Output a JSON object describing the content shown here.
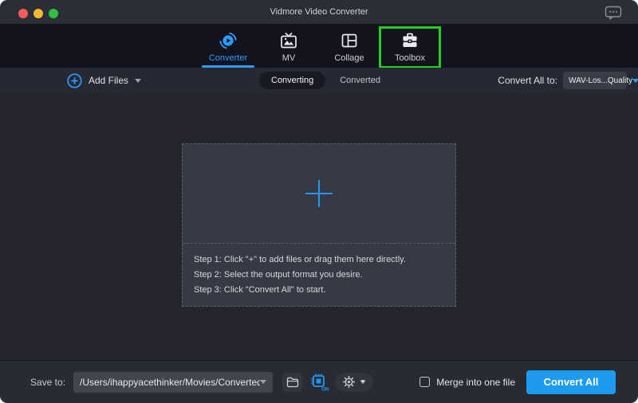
{
  "window": {
    "title": "Vidmore Video Converter"
  },
  "nav": {
    "tabs": [
      {
        "label": "Converter",
        "active": true
      },
      {
        "label": "MV",
        "active": false
      },
      {
        "label": "Collage",
        "active": false
      },
      {
        "label": "Toolbox",
        "active": false,
        "highlighted": true
      }
    ]
  },
  "toolbar": {
    "add_files_label": "Add Files",
    "view_tabs": [
      {
        "label": "Converting",
        "active": true
      },
      {
        "label": "Converted",
        "active": false
      }
    ],
    "convert_all_to_label": "Convert All to:",
    "format_value": "WAV-Los...Quality"
  },
  "dropzone": {
    "steps": [
      "Step 1: Click \"+\" to add files or drag them here directly.",
      "Step 2: Select the output format you desire.",
      "Step 3: Click \"Convert All\" to start."
    ]
  },
  "footer": {
    "save_to_label": "Save to:",
    "save_path": "/Users/ihappyacethinker/Movies/Converted",
    "hw_accel_badge": "ON",
    "merge_label": "Merge into one file",
    "convert_all_button": "Convert All"
  },
  "colors": {
    "accent_blue": "#2e9bff",
    "button_blue": "#1d9bf0",
    "highlight_green": "#24cd24",
    "icon_blue": "#2196f3"
  }
}
